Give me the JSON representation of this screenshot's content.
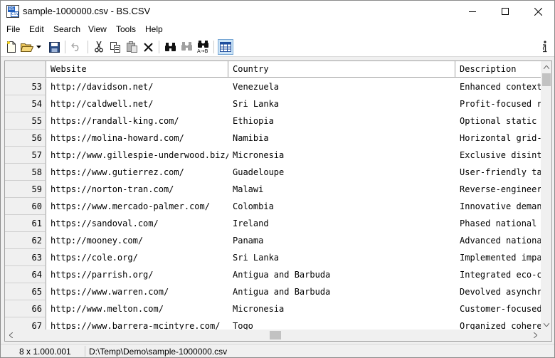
{
  "window": {
    "title": "sample-1000000.csv - BS.CSV",
    "icon_name": "bs-csv-app-icon",
    "icon_text_top": "BS",
    "icon_text_bottom": "CSV"
  },
  "menu": [
    "File",
    "Edit",
    "Search",
    "View",
    "Tools",
    "Help"
  ],
  "toolbar": {
    "buttons": [
      "new-icon",
      "open-icon",
      "open-dropdown-icon",
      "save-icon",
      "undo-icon",
      "cut-icon",
      "copy-icon",
      "paste-icon",
      "delete-icon",
      "find-icon",
      "find-next-icon",
      "replace-icon",
      "grid-view-icon",
      "info-icon"
    ],
    "active": "grid-view-icon"
  },
  "grid": {
    "columns": [
      "Website",
      "Country",
      "Description"
    ],
    "rows": [
      {
        "num": "53",
        "website": "http://davidson.net/",
        "country": "Venezuela",
        "description": "Enhanced context"
      },
      {
        "num": "54",
        "website": "http://caldwell.net/",
        "country": "Sri Lanka",
        "description": "Profit-focused r"
      },
      {
        "num": "55",
        "website": "https://randall-king.com/",
        "country": "Ethiopia",
        "description": "Optional static"
      },
      {
        "num": "56",
        "website": "https://molina-howard.com/",
        "country": "Namibia",
        "description": "Horizontal grid-"
      },
      {
        "num": "57",
        "website": "http://www.gillespie-underwood.biz/",
        "country": "Micronesia",
        "description": "Exclusive disint"
      },
      {
        "num": "58",
        "website": "https://www.gutierrez.com/",
        "country": "Guadeloupe",
        "description": "User-friendly ta"
      },
      {
        "num": "59",
        "website": "https://norton-tran.com/",
        "country": "Malawi",
        "description": "Reverse-engineer"
      },
      {
        "num": "60",
        "website": "https://www.mercado-palmer.com/",
        "country": "Colombia",
        "description": "Innovative deman"
      },
      {
        "num": "61",
        "website": "https://sandoval.com/",
        "country": "Ireland",
        "description": "Phased national"
      },
      {
        "num": "62",
        "website": "http://mooney.com/",
        "country": "Panama",
        "description": "Advanced nationa"
      },
      {
        "num": "63",
        "website": "https://cole.org/",
        "country": "Sri Lanka",
        "description": "Implemented impa"
      },
      {
        "num": "64",
        "website": "https://parrish.org/",
        "country": "Antigua and Barbuda",
        "description": "Integrated eco-c"
      },
      {
        "num": "65",
        "website": "https://www.warren.com/",
        "country": "Antigua and Barbuda",
        "description": "Devolved asynchr"
      },
      {
        "num": "66",
        "website": "http://www.melton.com/",
        "country": "Micronesia",
        "description": "Customer-focused"
      },
      {
        "num": "67",
        "website": "https://www.barrera-mcintyre.com/",
        "country": "Togo",
        "description": "Organized cohere"
      }
    ]
  },
  "status": {
    "dimensions": "8 x 1.000.001",
    "path": "D:\\Temp\\Demo\\sample-1000000.csv"
  }
}
